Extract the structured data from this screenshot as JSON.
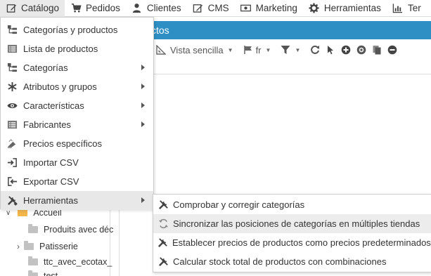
{
  "topbar": {
    "items": [
      {
        "label": "Catálogo",
        "icon": "edit-icon"
      },
      {
        "label": "Pedidos",
        "icon": "cart-icon"
      },
      {
        "label": "Clientes",
        "icon": "user-icon"
      },
      {
        "label": "CMS",
        "icon": "pencil-icon"
      },
      {
        "label": "Marketing",
        "icon": "money-icon"
      },
      {
        "label": "Herramientas",
        "icon": "gear-icon"
      },
      {
        "label": "Ter",
        "icon": "stats-icon"
      }
    ]
  },
  "header": {
    "title_fragment": "ctos"
  },
  "toolbar": {
    "view_label": "Vista sencilla",
    "lang_label": "fr"
  },
  "menu": {
    "items": [
      {
        "label": "Categorías y productos"
      },
      {
        "label": "Lista de productos"
      },
      {
        "label": "Categorías"
      },
      {
        "label": "Atributos y grupos"
      },
      {
        "label": "Características"
      },
      {
        "label": "Fabricantes"
      },
      {
        "label": "Precios específicos"
      },
      {
        "label": "Importar CSV"
      },
      {
        "label": "Exportar CSV"
      },
      {
        "label": "Herramientas"
      }
    ]
  },
  "submenu": {
    "items": [
      {
        "label": "Comprobar y corregir categorías"
      },
      {
        "label": "Sincronizar las posiciones de categorías en múltiples tiendas"
      },
      {
        "label": "Establecer precios de productos como precios predeterminados de"
      },
      {
        "label": "Calcular stock total de productos con combinaciones"
      }
    ]
  },
  "tree": {
    "items": [
      {
        "label": "Accueil"
      },
      {
        "label": "Produits avec déc"
      },
      {
        "label": "Patisserie"
      },
      {
        "label": "ttc_avec_ecotax_"
      },
      {
        "label": "test"
      }
    ]
  },
  "colors": {
    "header_blue": "#2d8fc3",
    "menu_hover": "#e8e8e8",
    "folder_yellow": "#f2b64a"
  }
}
